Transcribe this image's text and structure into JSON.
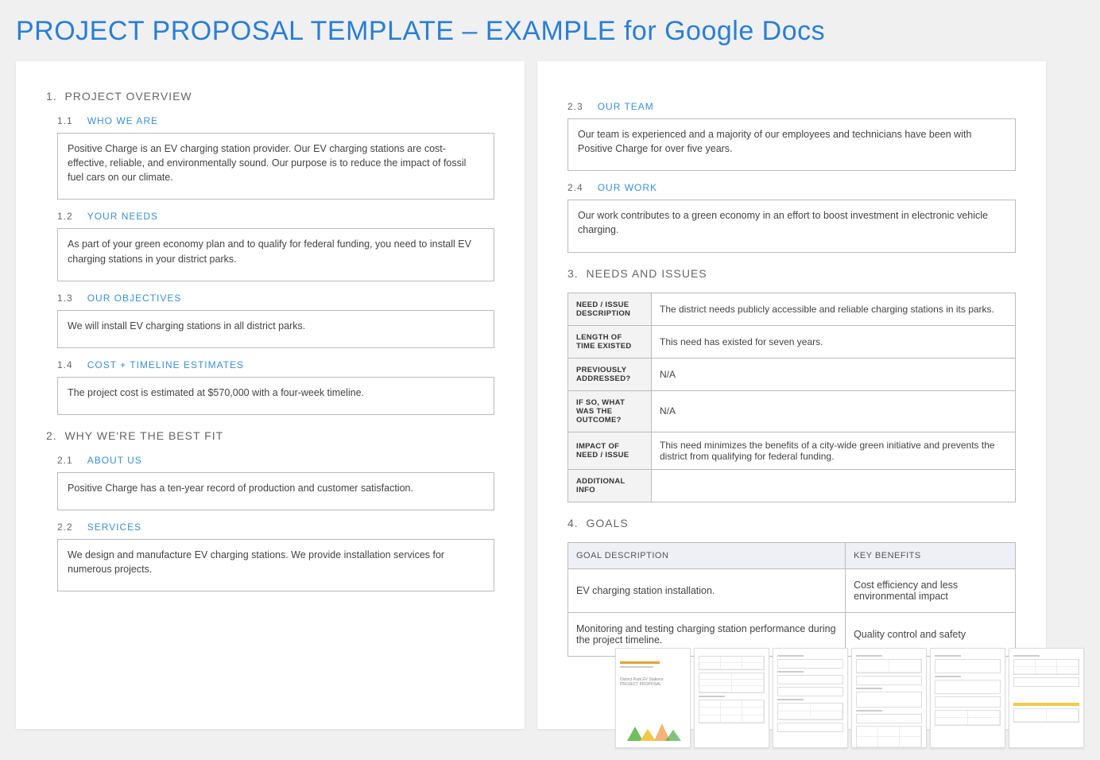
{
  "page_title": "PROJECT PROPOSAL TEMPLATE – EXAMPLE for Google Docs",
  "s1": {
    "num": "1.",
    "title": "PROJECT OVERVIEW",
    "sub1": {
      "num": "1.1",
      "title": "WHO WE ARE",
      "body": "Positive Charge is an EV charging station provider. Our EV charging stations are cost-effective, reliable, and environmentally sound. Our purpose is to reduce the impact of fossil fuel cars on our climate."
    },
    "sub2": {
      "num": "1.2",
      "title": "YOUR NEEDS",
      "body": "As part of your green economy plan and to qualify for federal funding, you need to install EV charging stations in your district parks."
    },
    "sub3": {
      "num": "1.3",
      "title": "OUR OBJECTIVES",
      "body": "We will install EV charging stations in all district parks."
    },
    "sub4": {
      "num": "1.4",
      "title": "COST + TIMELINE ESTIMATES",
      "body": "The project cost is estimated at $570,000 with a four-week timeline."
    }
  },
  "s2": {
    "num": "2.",
    "title": "WHY WE'RE THE BEST FIT",
    "sub1": {
      "num": "2.1",
      "title": "ABOUT US",
      "body": "Positive Charge has a ten-year record of production and customer satisfaction."
    },
    "sub2": {
      "num": "2.2",
      "title": "SERVICES",
      "body": "We design and manufacture EV charging stations. We provide installation services for numerous projects."
    },
    "sub3": {
      "num": "2.3",
      "title": "OUR TEAM",
      "body": "Our team is experienced and a majority of our employees and technicians have been with Positive Charge for over five years."
    },
    "sub4": {
      "num": "2.4",
      "title": "OUR WORK",
      "body": "Our work contributes to a green economy in an effort to boost investment in electronic vehicle charging."
    }
  },
  "s3": {
    "num": "3.",
    "title": "NEEDS AND ISSUES",
    "rows": [
      {
        "label": "NEED / ISSUE DESCRIPTION",
        "value": "The district needs publicly accessible and reliable charging stations in its parks."
      },
      {
        "label": "LENGTH OF TIME EXISTED",
        "value": "This need has existed for seven years."
      },
      {
        "label": "PREVIOUSLY ADDRESSED?",
        "value": "N/A"
      },
      {
        "label": "IF SO, WHAT WAS THE OUTCOME?",
        "value": "N/A"
      },
      {
        "label": "IMPACT OF NEED / ISSUE",
        "value": "This need minimizes the benefits of a city-wide green initiative and prevents the district from qualifying for federal funding."
      },
      {
        "label": "ADDITIONAL INFO",
        "value": ""
      }
    ]
  },
  "s4": {
    "num": "4.",
    "title": "GOALS",
    "headers": {
      "col1": "GOAL DESCRIPTION",
      "col2": "KEY BENEFITS"
    },
    "rows": [
      {
        "desc": "EV charging station installation.",
        "benefit": "Cost efficiency and less environmental impact"
      },
      {
        "desc": "Monitoring and testing charging station performance during the project timeline.",
        "benefit": "Quality control and safety"
      }
    ]
  },
  "thumb_cover": {
    "title": "District Park EV Stations",
    "subtitle": "PROJECT PROPOSAL"
  }
}
